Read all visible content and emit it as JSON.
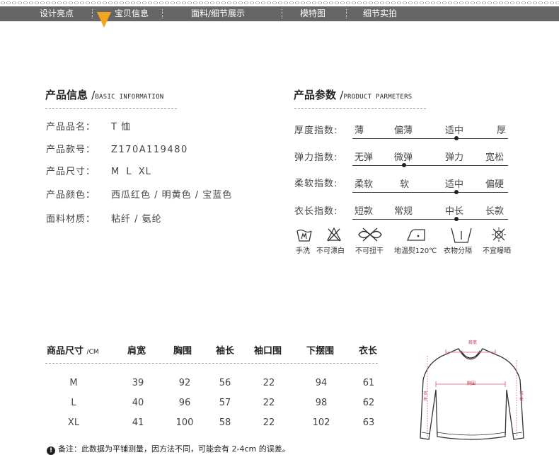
{
  "nav": {
    "items": [
      "设计亮点",
      "宝贝信息",
      "面料/细节展示",
      "模特图",
      "细节实拍"
    ]
  },
  "product_info": {
    "title": "产品信息",
    "subtitle": "BASIC INFORMATION",
    "rows": [
      {
        "label": "产品品名：",
        "value": "T 恤"
      },
      {
        "label": "产品款号：",
        "value": "Z170A119480"
      },
      {
        "label": "产品尺寸：",
        "value": "M L XL"
      },
      {
        "label": "产品颜色：",
        "value": "西瓜红色 / 明黄色 / 宝蓝色"
      },
      {
        "label": "面料材质：",
        "value": "粘纤 / 氨纶"
      }
    ]
  },
  "product_params": {
    "title": "产品参数",
    "subtitle": "PRODUCT PARMETERS",
    "rows": [
      {
        "label": "厚度指数:",
        "options": [
          "薄",
          "偏薄",
          "适中",
          "厚"
        ],
        "selected": 2
      },
      {
        "label": "弹力指数:",
        "options": [
          "无弹",
          "微弹",
          "弹力",
          "宽松"
        ],
        "selected": 1
      },
      {
        "label": "柔软指数:",
        "options": [
          "柔软",
          "软",
          "适中",
          "偏硬"
        ],
        "selected": 2
      },
      {
        "label": "衣长指数:",
        "options": [
          "短款",
          "常规",
          "中长",
          "长款"
        ],
        "selected": 2
      }
    ],
    "care": [
      {
        "icon": "hand-wash-icon",
        "label": "手洗"
      },
      {
        "icon": "no-bleach-icon",
        "label": "不可漂白"
      },
      {
        "icon": "no-wring-icon",
        "label": "不可扭干"
      },
      {
        "icon": "low-iron-icon",
        "label": "地温熨120℃"
      },
      {
        "icon": "separate-wash-icon",
        "label": "衣物分隔"
      },
      {
        "icon": "no-sun-dry-icon",
        "label": "不宜曝晒"
      }
    ]
  },
  "size_table": {
    "header": [
      "商品尺寸",
      "肩宽",
      "胸围",
      "袖长",
      "袖口围",
      "下摆围",
      "衣长"
    ],
    "unit": "CM",
    "rows": [
      [
        "M",
        "39",
        "92",
        "56",
        "22",
        "94",
        "61"
      ],
      [
        "L",
        "40",
        "96",
        "57",
        "22",
        "98",
        "62"
      ],
      [
        "XL",
        "41",
        "100",
        "58",
        "22",
        "102",
        "63"
      ]
    ],
    "note_icon": "!",
    "note": "备注：此数据为平铺测量，因方法不同，可能会有 2-4cm 的误差。"
  },
  "diagram": {
    "shoulder": "肩宽",
    "chest": "胸围",
    "length": "衣长"
  }
}
